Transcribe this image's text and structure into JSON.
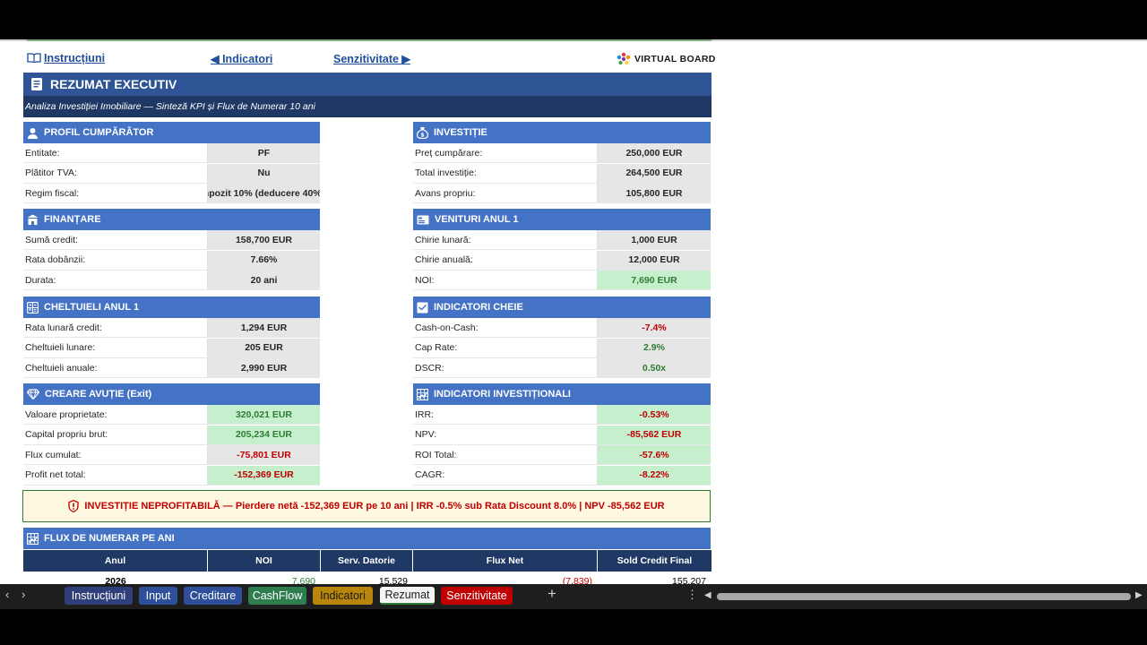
{
  "nav": {
    "instructions": "Instrucțiuni",
    "indicators": "◀ Indicatori",
    "sensitivity": "Senzitivitate ▶",
    "logo_text": "VIRTUAL BOARD"
  },
  "banner": {
    "title": "REZUMAT EXECUTIV",
    "subtitle": "Analiza Investiției Imobiliare — Sinteză KPI și Flux de Numerar 10 ani"
  },
  "sections": {
    "profil": {
      "title": "PROFIL CUMPĂRĂTOR",
      "rows": [
        {
          "label": "Entitate:",
          "value": "PF"
        },
        {
          "label": "Plătitor TVA:",
          "value": "Nu"
        },
        {
          "label": "Regim fiscal:",
          "value": "npozit 10% (deducere 40%)"
        }
      ]
    },
    "investitie": {
      "title": "INVESTIȚIE",
      "rows": [
        {
          "label": "Preț cumpărare:",
          "value": "250,000 EUR"
        },
        {
          "label": "Total investiție:",
          "value": "264,500 EUR"
        },
        {
          "label": "Avans propriu:",
          "value": "105,800 EUR"
        }
      ]
    },
    "finantare": {
      "title": "FINANȚARE",
      "rows": [
        {
          "label": "Sumă credit:",
          "value": "158,700 EUR"
        },
        {
          "label": "Rata dobânzii:",
          "value": "7.66%"
        },
        {
          "label": "Durata:",
          "value": "20 ani"
        }
      ]
    },
    "venituri": {
      "title": "VENITURI ANUL 1",
      "rows": [
        {
          "label": "Chirie lunară:",
          "value": "1,000 EUR"
        },
        {
          "label": "Chirie anuală:",
          "value": "12,000 EUR"
        },
        {
          "label": "NOI:",
          "value": "7,690 EUR"
        }
      ]
    },
    "cheltuieli": {
      "title": "CHELTUIELI ANUL 1",
      "rows": [
        {
          "label": "Rata lunară credit:",
          "value": "1,294 EUR"
        },
        {
          "label": "Cheltuieli lunare:",
          "value": "205 EUR"
        },
        {
          "label": "Cheltuieli anuale:",
          "value": "2,990 EUR"
        }
      ]
    },
    "cheie": {
      "title": "INDICATORI CHEIE",
      "rows": [
        {
          "label": "Cash-on-Cash:",
          "value": "-7.4%"
        },
        {
          "label": "Cap Rate:",
          "value": "2.9%"
        },
        {
          "label": "DSCR:",
          "value": "0.50x"
        }
      ]
    },
    "avutie": {
      "title": "CREARE AVUȚIE (Exit)",
      "rows": [
        {
          "label": "Valoare proprietate:",
          "value": "320,021 EUR"
        },
        {
          "label": "Capital propriu brut:",
          "value": "205,234 EUR"
        },
        {
          "label": "Flux cumulat:",
          "value": "-75,801 EUR"
        },
        {
          "label": "Profit net total:",
          "value": "-152,369 EUR"
        }
      ]
    },
    "investitionali": {
      "title": "INDICATORI INVESTIȚIONALI",
      "rows": [
        {
          "label": "IRR:",
          "value": "-0.53%"
        },
        {
          "label": "NPV:",
          "value": "-85,562 EUR"
        },
        {
          "label": "ROI Total:",
          "value": "-57.6%"
        },
        {
          "label": "CAGR:",
          "value": "-8.22%"
        }
      ]
    }
  },
  "alert": {
    "text": "INVESTIȚIE NEPROFITABILĂ — Pierdere netă -152,369 EUR pe 10 ani | IRR -0.5% sub Rata Discount 8.0% | NPV -85,562 EUR"
  },
  "cashflow": {
    "title": "FLUX DE NUMERAR PE ANI",
    "columns": [
      "Anul",
      "NOI",
      "Serv. Datorie",
      "Flux Net",
      "Sold Credit Final"
    ],
    "first_row": [
      "2026",
      "7,690",
      "15,529",
      "(7,839)",
      "155,207"
    ]
  },
  "tabs": [
    {
      "label": "Instrucțiuni",
      "color": "#2f3f7a"
    },
    {
      "label": "Input",
      "color": "#2f4f9a"
    },
    {
      "label": "Creditare",
      "color": "#2f4f9a"
    },
    {
      "label": "CashFlow",
      "color": "#2e7d4f"
    },
    {
      "label": "Indicatori",
      "color": "#b8860b"
    },
    {
      "label": "Rezumat",
      "color": "#f3f3f3"
    },
    {
      "label": "Senzitivitate",
      "color": "#c00000"
    }
  ],
  "colors": {
    "header_dark": "#1f3864",
    "header_mid": "#2f5597",
    "section": "#4472c4",
    "negative": "#c00000",
    "positive": "#2e7d32"
  }
}
